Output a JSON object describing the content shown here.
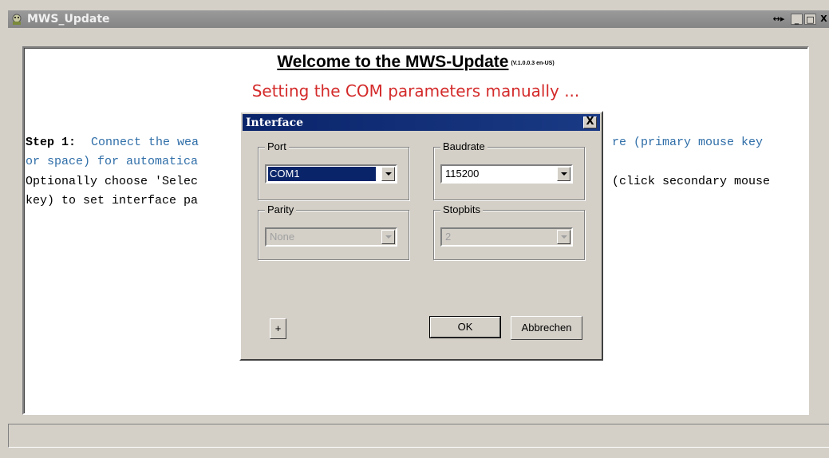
{
  "window": {
    "title": "MWS_Update",
    "title_icon": "app-icon",
    "buttons": {
      "resize": "↔▸",
      "minimize": "_",
      "maximize": "□",
      "close": "X"
    }
  },
  "main": {
    "heading": "Welcome to the MWS-Update",
    "version": "(V.1.0.0.3 en-US)",
    "subheading": "Setting the COM parameters manually ...",
    "step_label": "Step 1:",
    "line1_left": " Connect the wea",
    "line1_right": "re (primary mouse key",
    "line2": "or space) for automatica",
    "line3_left": "Optionally choose 'Selec",
    "line3_right": "(click secondary mouse",
    "line4": "key) to set interface pa"
  },
  "dialog": {
    "title": "Interface",
    "close_label": "X",
    "port": {
      "label": "Port",
      "value": "COM1"
    },
    "baudrate": {
      "label": "Baudrate",
      "value": "115200"
    },
    "parity": {
      "label": "Parity",
      "value": "None"
    },
    "stopbits": {
      "label": "Stopbits",
      "value": "2"
    },
    "plus_label": "+",
    "ok_label": "OK",
    "cancel_label": "Abbrechen"
  },
  "colors": {
    "accent": "#0a246a",
    "subheading": "#d42a2a",
    "step_text": "#2f6ea8"
  }
}
